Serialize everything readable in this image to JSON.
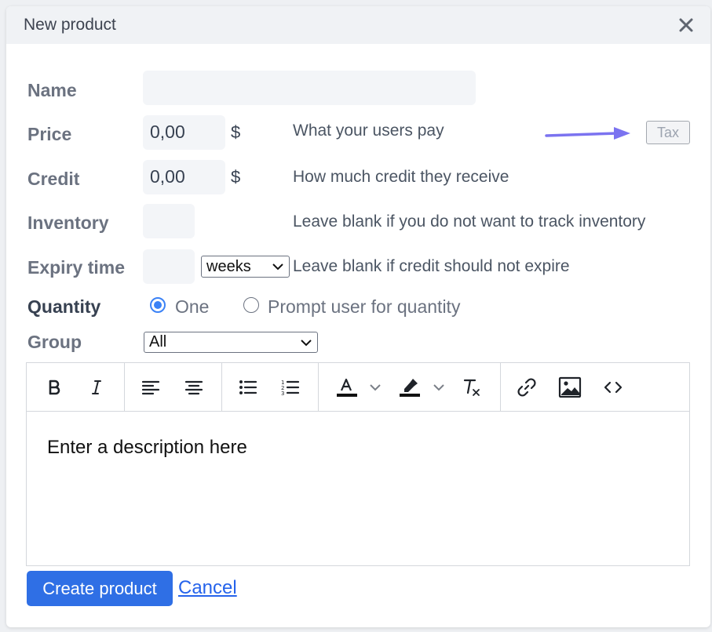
{
  "modal": {
    "title": "New product"
  },
  "form": {
    "name": {
      "label": "Name",
      "value": ""
    },
    "price": {
      "label": "Price",
      "value": "0,00",
      "unit": "$",
      "hint": "What your users pay",
      "tax_label": "Tax"
    },
    "credit": {
      "label": "Credit",
      "value": "0,00",
      "unit": "$",
      "hint": "How much credit they receive"
    },
    "inventory": {
      "label": "Inventory",
      "value": "",
      "hint": "Leave blank if you do not want to track inventory"
    },
    "expiry": {
      "label": "Expiry time",
      "value": "",
      "unit_selected": "weeks",
      "hint": "Leave blank if credit should not expire"
    },
    "quantity": {
      "label": "Quantity",
      "options": [
        "One",
        "Prompt user for quantity"
      ],
      "selected": "One"
    },
    "group": {
      "label": "Group",
      "selected": "All"
    }
  },
  "editor": {
    "toolbar": [
      "bold-icon",
      "italic-icon",
      "align-left-icon",
      "align-center-icon",
      "bullet-list-icon",
      "numbered-list-icon",
      "text-color-icon",
      "highlight-icon",
      "clear-format-icon",
      "link-icon",
      "image-icon",
      "code-icon"
    ],
    "content": "Enter a description here"
  },
  "actions": {
    "submit_label": "Create product",
    "cancel_label": "Cancel"
  },
  "colors": {
    "primary": "#2f6fe5",
    "annotation_arrow": "#7b73f0",
    "radio_accent": "#3b82f6"
  }
}
